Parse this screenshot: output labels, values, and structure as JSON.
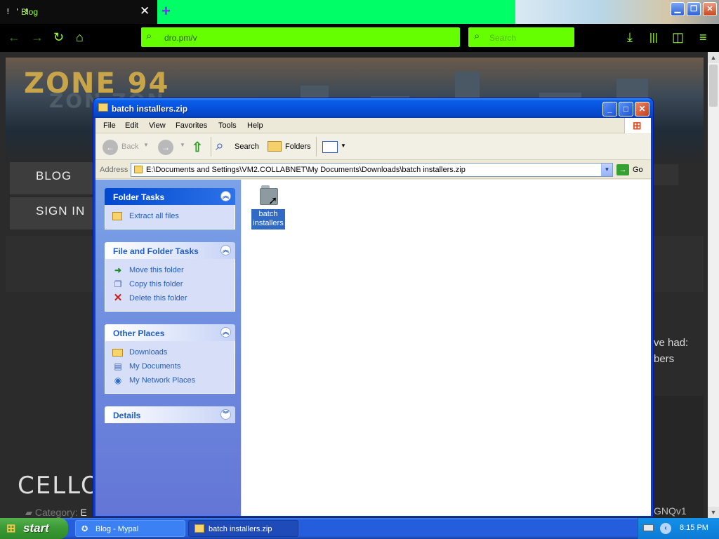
{
  "browser": {
    "tab": {
      "favicon": "! ' !",
      "title": "Blog",
      "close": "✕"
    },
    "newtab": "+",
    "win_buttons": {
      "minimize": "▁",
      "restore": "❐",
      "close": "✕"
    },
    "url": "dro.pm/v",
    "search_placeholder": "Search",
    "icons": [
      "back-icon",
      "forward-icon",
      "reload-icon",
      "home-icon",
      "download-icon",
      "library-icon",
      "sidebar-icon",
      "menu-icon"
    ]
  },
  "webpage": {
    "logo": "ZONE 94",
    "logo_ghost": "ZON ZON",
    "menu": [
      "BLOG",
      "SIGN IN"
    ],
    "snippet_1": "ve had:",
    "snippet_2": "bers",
    "mark": "!",
    "code": "GNQv1",
    "headline": "CELLO C",
    "category_label": "Category:",
    "category_value": "E"
  },
  "explorer": {
    "title": "batch installers.zip",
    "caption_buttons": {
      "minimize": "_",
      "maximize": "□",
      "close": "✕"
    },
    "menu": [
      "File",
      "Edit",
      "View",
      "Favorites",
      "Tools",
      "Help"
    ],
    "toolbar": {
      "back": "Back",
      "forward": "",
      "search": "Search",
      "folders": "Folders"
    },
    "address_label": "Address",
    "address_value": "E:\\Documents and Settings\\VM2.COLLABNET\\My Documents\\Downloads\\batch installers.zip",
    "go_label": "Go",
    "task_groups": [
      {
        "title": "Folder Tasks",
        "tasks": [
          "Extract all files"
        ]
      },
      {
        "title": "File and Folder Tasks",
        "tasks": [
          "Move this folder",
          "Copy this folder",
          "Delete this folder"
        ]
      },
      {
        "title": "Other Places",
        "tasks": [
          "Downloads",
          "My Documents",
          "My Network Places"
        ]
      },
      {
        "title": "Details",
        "tasks": []
      }
    ],
    "files": [
      {
        "name": "batch installers",
        "selected": true
      }
    ]
  },
  "taskbar": {
    "start_label": "start",
    "buttons": [
      {
        "label": "Blog - Mypal",
        "active": false
      },
      {
        "label": "batch installers.zip",
        "active": true
      }
    ],
    "clock": "8:15 PM"
  },
  "colors": {
    "ff_accent": "#66ff00",
    "xp_title_blue": "#0651dc",
    "xp_taskpane_top": "#7ba2e7",
    "xp_selection": "#316ac5",
    "xp_start_green": "#3c9b36"
  }
}
